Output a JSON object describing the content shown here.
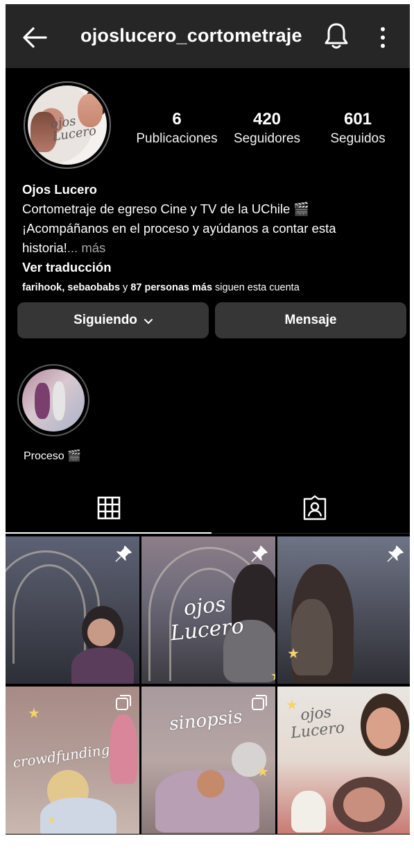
{
  "header": {
    "username": "ojoslucero_cortometraje"
  },
  "profile": {
    "avatar_text": "ojos Lucero",
    "stats": [
      {
        "value": "6",
        "label": "Publicaciones"
      },
      {
        "value": "420",
        "label": "Seguidores"
      },
      {
        "value": "601",
        "label": "Seguidos"
      }
    ],
    "name": "Ojos Lucero",
    "bio_line1": "Cortometraje de egreso Cine y TV de la UChile 🎬",
    "bio_line2": "¡Acompáñanos en el proceso y ayúdanos a contar esta",
    "bio_line3": "historia!",
    "bio_more": "... más",
    "translate": "Ver traducción",
    "followed_by_names": "farihook, sebaobabs",
    "followed_by_mid": " y ",
    "followed_by_count": "87 personas más",
    "followed_by_tail": " siguen esta cuenta"
  },
  "actions": {
    "following_label": "Siguiendo",
    "message_label": "Mensaje"
  },
  "highlights": [
    {
      "label": "Proceso 🎬"
    }
  ],
  "tabs": {
    "active": "grid",
    "items": [
      "grid-icon",
      "tagged-icon"
    ]
  },
  "posts": [
    {
      "caption": "",
      "badge": "pin-icon"
    },
    {
      "caption": "ojos Lucero",
      "badge": "pin-icon"
    },
    {
      "caption": "",
      "badge": "pin-icon"
    },
    {
      "caption": "crowdfunding",
      "badge": "multi-icon"
    },
    {
      "caption": "sinopsis",
      "badge": "multi-icon"
    },
    {
      "caption": "ojos Lucero",
      "badge": ""
    }
  ],
  "colors": {
    "background": "#000000",
    "topbar": "#262626",
    "button": "#363636",
    "muted_text": "#a8a8a8"
  }
}
